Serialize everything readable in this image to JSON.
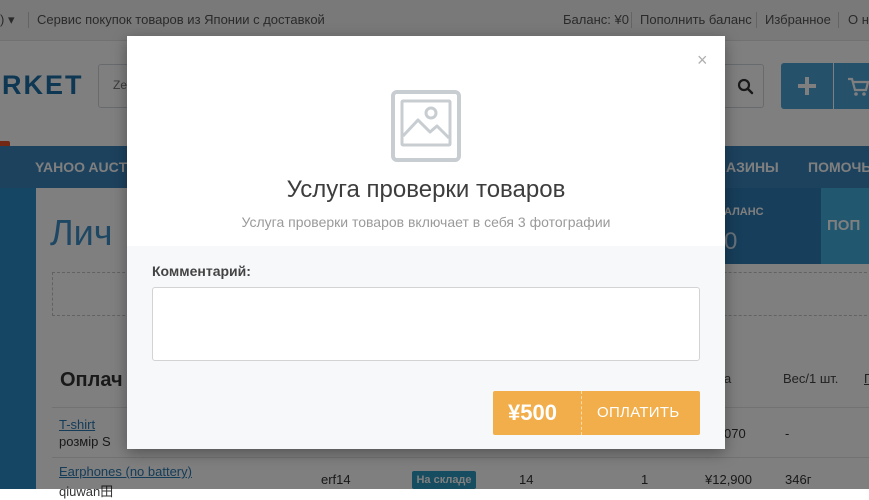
{
  "topbar": {
    "left_fragment": ") ▾",
    "tagline": "Сервис покупок товаров из Японии с доставкой",
    "balance": "Баланс: ¥0",
    "topup": "Пополнить баланс",
    "favorites": "Избранное",
    "about_fragment": "О на"
  },
  "header": {
    "logo_fragment": "RKET",
    "search_placeholder": "Ze",
    "search_icon": "search-icon",
    "add_icon": "plus-icon",
    "cart_icon": "cart-icon"
  },
  "nav": {
    "items": [
      "YAHOO AUCT",
      "АЗИНЫ",
      "ПОМОЧЬ"
    ]
  },
  "page": {
    "title_fragment": "Лич",
    "balance_label": "АЛАНС",
    "balance_value": "0",
    "topup_fragment": "ПОП",
    "section_title_fragment": "Оплач",
    "columns": [
      "а",
      "Вес/1 шт.",
      "П"
    ],
    "rows": [
      {
        "name": "T-shirt",
        "variant": "розмір S",
        "price_fragment": "070",
        "weight": "-"
      },
      {
        "name": "Earphones (no battery)",
        "variant": "qiuwan田",
        "code": "erf14",
        "status": "На складе",
        "qty": "14",
        "count": "1",
        "price": "¥12,900",
        "weight": "346г"
      }
    ]
  },
  "modal": {
    "close": "×",
    "image_icon": "image-placeholder-icon",
    "title": "Услуга проверки товаров",
    "subtitle": "Услуга проверки товаров включает в себя 3 фотографии",
    "comment_label": "Комментарий:",
    "comment_value": "",
    "price": "¥500",
    "pay_label": "ОПЛАТИТЬ"
  },
  "colors": {
    "accent_blue": "#3a85bc",
    "pay_orange": "#f2ae4a",
    "overlay": "rgba(0,0,0,0.5)"
  }
}
